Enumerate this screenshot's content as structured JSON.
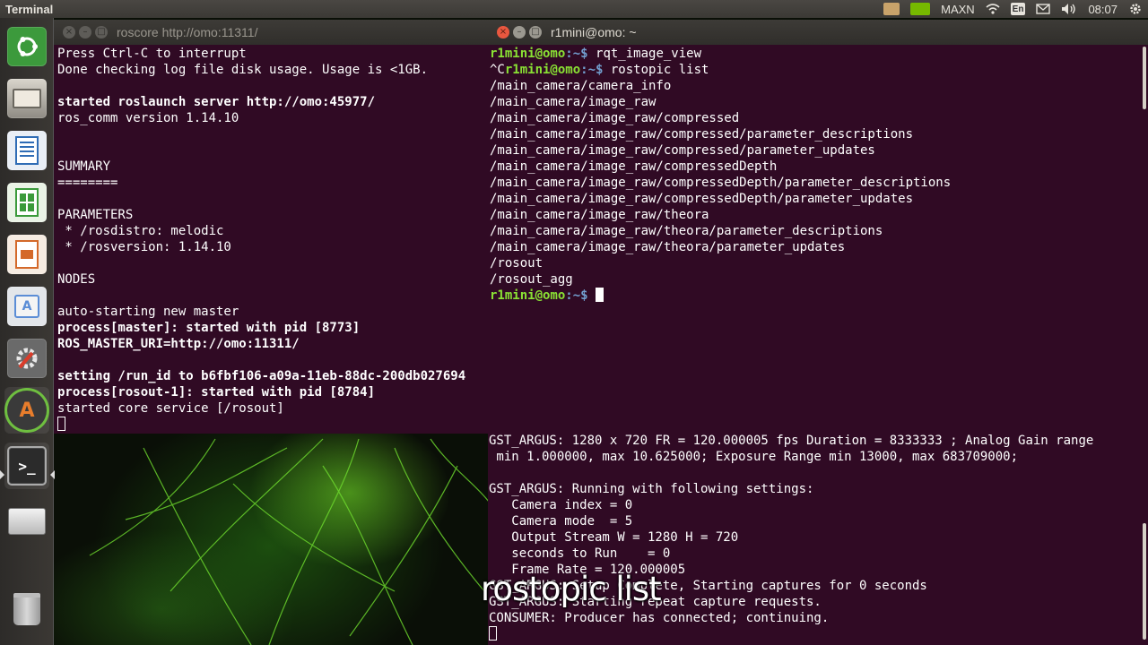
{
  "top_panel": {
    "app_title": "Terminal",
    "tray": {
      "keyboard_layout": "En",
      "power_mode": "MAXN",
      "clock": "08:07",
      "icons": [
        "folder-icon",
        "nvidia-icon",
        "wifi-icon",
        "keyboard-icon",
        "mail-icon",
        "volume-icon",
        "gear-icon"
      ]
    }
  },
  "launcher": {
    "items": [
      "ubuntu-dash-icon",
      "files-icon",
      "writer-icon",
      "calc-icon",
      "impress-icon",
      "software-center-icon",
      "settings-icon",
      "software-updater-icon",
      "terminal-icon",
      "drive-icon",
      "trash-icon"
    ]
  },
  "roscore_window": {
    "title": "roscore http://omo:11311/",
    "lines": [
      {
        "text": "Press Ctrl-C to interrupt",
        "bold": false
      },
      {
        "text": "Done checking log file disk usage. Usage is <1GB.",
        "bold": false
      },
      {
        "text": "",
        "bold": false
      },
      {
        "text": "started roslaunch server http://omo:45977/",
        "bold": true
      },
      {
        "text": "ros_comm version 1.14.10",
        "bold": false
      },
      {
        "text": "",
        "bold": false
      },
      {
        "text": "",
        "bold": false
      },
      {
        "text": "SUMMARY",
        "bold": false
      },
      {
        "text": "========",
        "bold": false
      },
      {
        "text": "",
        "bold": false
      },
      {
        "text": "PARAMETERS",
        "bold": false
      },
      {
        "text": " * /rosdistro: melodic",
        "bold": false
      },
      {
        "text": " * /rosversion: 1.14.10",
        "bold": false
      },
      {
        "text": "",
        "bold": false
      },
      {
        "text": "NODES",
        "bold": false
      },
      {
        "text": "",
        "bold": false
      },
      {
        "text": "auto-starting new master",
        "bold": false
      },
      {
        "text": "process[master]: started with pid [8773]",
        "bold": true
      },
      {
        "text": "ROS_MASTER_URI=http://omo:11311/",
        "bold": true
      },
      {
        "text": "",
        "bold": false
      },
      {
        "text": "setting /run_id to b6fbf106-a09a-11eb-88dc-200db027694",
        "bold": true
      },
      {
        "text": "process[rosout-1]: started with pid [8784]",
        "bold": true
      },
      {
        "text": "started core service [/rosout]",
        "bold": false
      }
    ]
  },
  "rostopic_window": {
    "title": "r1mini@omo: ~",
    "prompt_user": "r1mini@omo",
    "prompt_path": ":~$",
    "commands": [
      {
        "prefix": "",
        "prompt": "r1mini@omo",
        "path": ":~$",
        "command": " rqt_image_view"
      },
      {
        "prefix": "^C",
        "prompt": "r1mini@omo",
        "path": ":~$",
        "command": " rostopic list"
      }
    ],
    "topics": [
      "/main_camera/camera_info",
      "/main_camera/image_raw",
      "/main_camera/image_raw/compressed",
      "/main_camera/image_raw/compressed/parameter_descriptions",
      "/main_camera/image_raw/compressed/parameter_updates",
      "/main_camera/image_raw/compressedDepth",
      "/main_camera/image_raw/compressedDepth/parameter_descriptions",
      "/main_camera/image_raw/compressedDepth/parameter_updates",
      "/main_camera/image_raw/theora",
      "/main_camera/image_raw/theora/parameter_descriptions",
      "/main_camera/image_raw/theora/parameter_updates",
      "/rosout",
      "/rosout_agg"
    ]
  },
  "gst_window": {
    "lines": [
      "GST_ARGUS: 1280 x 720 FR = 120.000005 fps Duration = 8333333 ; Analog Gain range",
      " min 1.000000, max 10.625000; Exposure Range min 13000, max 683709000;",
      "",
      "GST_ARGUS: Running with following settings:",
      "   Camera index = 0",
      "   Camera mode  = 5",
      "   Output Stream W = 1280 H = 720",
      "   seconds to Run    = 0",
      "   Frame Rate = 120.000005",
      "GST_ARGUS: Setup Complete, Starting captures for 0 seconds",
      "GST_ARGUS: Starting repeat capture requests.",
      "CONSUMER: Producer has connected; continuing."
    ]
  },
  "caption": "rostopic list"
}
